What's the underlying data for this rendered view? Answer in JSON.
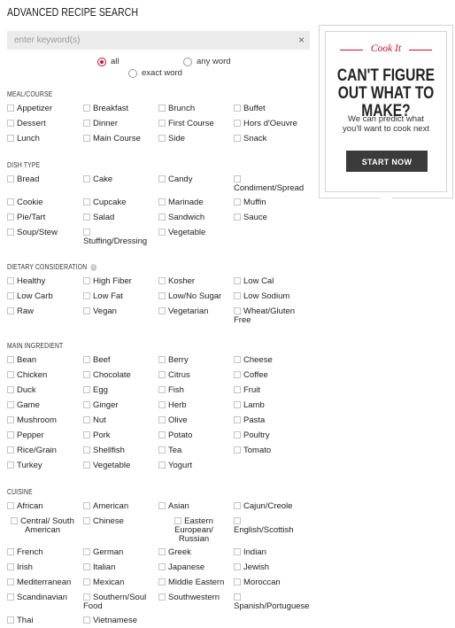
{
  "page_title": "ADVANCED RECIPE SEARCH",
  "search": {
    "placeholder": "enter keyword(s)",
    "value": "",
    "clear_icon": "×"
  },
  "match_mode": {
    "options": [
      {
        "label": "all",
        "selected": true
      },
      {
        "label": "any word",
        "selected": false
      },
      {
        "label": "exact word",
        "selected": false
      }
    ]
  },
  "sections": [
    {
      "title": "MEAL/COURSE",
      "has_info": false,
      "items": [
        "Appetizer",
        "Breakfast",
        "Brunch",
        "Buffet",
        "Dessert",
        "Dinner",
        "First Course",
        "Hors d'Oeuvre",
        "Lunch",
        "Main Course",
        "Side",
        "Snack"
      ]
    },
    {
      "title": "DISH TYPE",
      "has_info": false,
      "items": [
        "Bread",
        "Cake",
        "Candy",
        "Condiment/Spread",
        "Cookie",
        "Cupcake",
        "Marinade",
        "Muffin",
        "Pie/Tart",
        "Salad",
        "Sandwich",
        "Sauce",
        "Soup/Stew",
        "Stuffing/Dressing",
        "Vegetable"
      ]
    },
    {
      "title": "DIETARY CONSIDERATION",
      "has_info": true,
      "items": [
        "Healthy",
        "High Fiber",
        "Kosher",
        "Low Cal",
        "Low Carb",
        "Low Fat",
        "Low/No Sugar",
        "Low Sodium",
        "Raw",
        "Vegan",
        "Vegetarian",
        "Wheat/Gluten Free"
      ]
    },
    {
      "title": "MAIN INGREDIENT",
      "has_info": false,
      "items": [
        "Bean",
        "Beef",
        "Berry",
        "Cheese",
        "Chicken",
        "Chocolate",
        "Citrus",
        "Coffee",
        "Duck",
        "Egg",
        "Fish",
        "Fruit",
        "Game",
        "Ginger",
        "Herb",
        "Lamb",
        "Mushroom",
        "Nut",
        "Olive",
        "Pasta",
        "Pepper",
        "Pork",
        "Potato",
        "Poultry",
        "Rice/Grain",
        "Shellfish",
        "Tea",
        "Tomato",
        "Turkey",
        "Vegetable",
        "Yogurt"
      ]
    },
    {
      "title": "CUISINE",
      "has_info": false,
      "items": [
        "African",
        "American",
        "Asian",
        "Cajun/Creole",
        "Central/ South American",
        "Chinese",
        "Eastern European/ Russian",
        "English/Scottish",
        "French",
        "German",
        "Greek",
        "Indian",
        "Irish",
        "Italian",
        "Japanese",
        "Jewish",
        "Mediterranean",
        "Mexican",
        "Middle Eastern",
        "Moroccan",
        "Scandinavian",
        "Southern/Soul Food",
        "Southwestern",
        "Spanish/Portuguese",
        "Thai",
        "Vietnamese"
      ]
    }
  ],
  "promo": {
    "brand": "Cook It",
    "headline": "CAN'T FIGURE OUT WHAT TO MAKE?",
    "text": "We can predict what you'll want to cook next",
    "button": "START NOW"
  },
  "colors": {
    "accent": "#c8102e",
    "button_bg": "#3b3b3b",
    "search_bg": "#ebebeb"
  },
  "icons": {
    "clear": "close-icon",
    "info": "info-icon"
  }
}
